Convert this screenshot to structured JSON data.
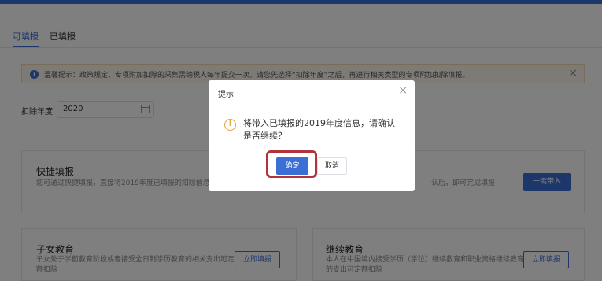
{
  "tabs": [
    {
      "label": "可填报",
      "active": true
    },
    {
      "label": "已填报",
      "active": false
    }
  ],
  "notice": {
    "text": "温馨提示：政策规定，专项附加扣除的采集需纳税人每年提交一次。请您先选择“扣除年度”之后，再进行相关类型的专项附加扣除填报。",
    "close_icon": "×"
  },
  "year": {
    "label": "扣除年度",
    "value": "2020"
  },
  "quick": {
    "title": "快捷填报",
    "desc_left": "您可通过快捷填报，直接将2019年度已填报的扣除信息",
    "desc_right": "认后，即可完成填报",
    "button": "一键带入"
  },
  "cards": [
    {
      "title": "子女教育",
      "desc": "子女处于学前教育阶段或者接受全日制学历教育的相关支出可定额扣除",
      "button": "立即填报"
    },
    {
      "title": "继续教育",
      "desc": "本人在中国境内接受学历（学位）继续教育和职业资格继续教育的支出可定额扣除",
      "button": "立即填报"
    }
  ],
  "dialog": {
    "title": "提示",
    "close_icon": "×",
    "warn_icon": "!",
    "message": "将带入已填报的2019年度信息，请确认是否继续？",
    "ok": "确定",
    "cancel": "取消"
  },
  "colors": {
    "accent": "#3a6fd6",
    "highlight": "#b0323a",
    "warning": "#e6a23c"
  }
}
